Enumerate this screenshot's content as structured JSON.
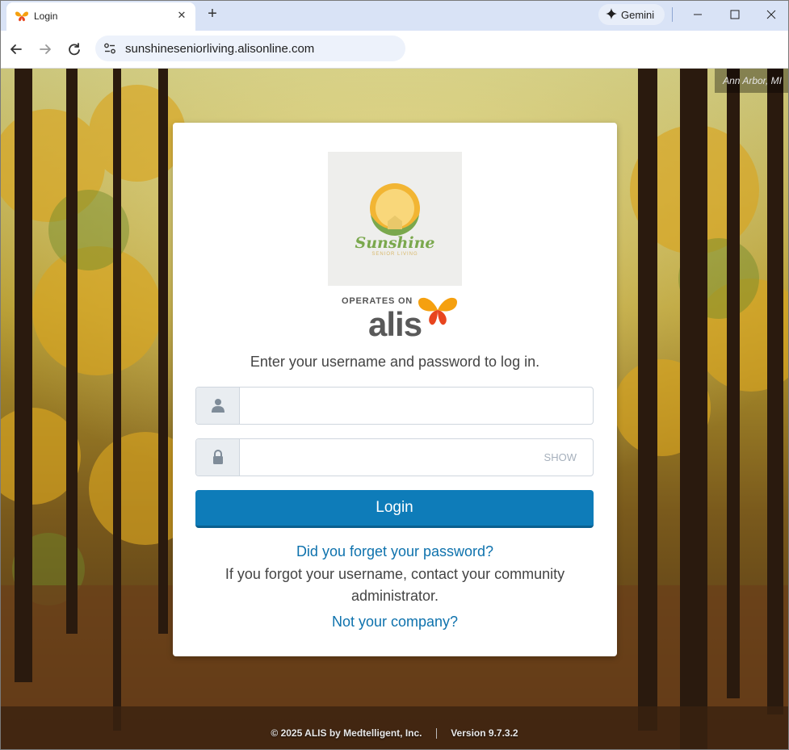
{
  "browser": {
    "tab_title": "Login",
    "new_tab_label": "+",
    "close_tab_label": "✕",
    "gemini_label": "Gemini",
    "url": "sunshineseniorliving.alisonline.com"
  },
  "background": {
    "location": "Ann Arbor, MI"
  },
  "login": {
    "company_logo": {
      "name": "Sunshine",
      "tagline": "SENIOR LIVING"
    },
    "operates_on": "OPERATES ON",
    "platform_name": "alis",
    "instruction": "Enter your username and password to log in.",
    "username": {
      "value": "",
      "placeholder": "",
      "icon": "user-icon"
    },
    "password": {
      "value": "",
      "placeholder": "",
      "icon": "lock-icon",
      "toggle_label": "SHOW"
    },
    "submit_label": "Login",
    "forgot_password_link": "Did you forget your password?",
    "forgot_username_text": "If you forgot your username, contact your community administrator.",
    "not_your_company_link": "Not your company?"
  },
  "footer": {
    "copyright": "© 2025 ALIS by Medtelligent, Inc.",
    "version": "Version 9.7.3.2"
  },
  "colors": {
    "primary_button": "#0e7cb9",
    "link": "#0e72ad",
    "alis_orange": "#f5a00f",
    "alis_red": "#e8451e"
  }
}
